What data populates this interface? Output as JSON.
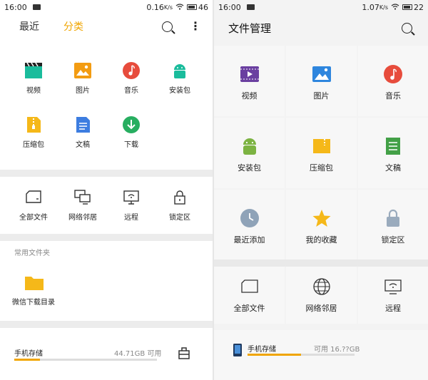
{
  "left": {
    "status": {
      "time": "16:00",
      "net": "0.16",
      "battery": "46"
    },
    "tabs": [
      "最近",
      "分类"
    ],
    "categories": [
      "视频",
      "图片",
      "音乐",
      "安装包",
      "压缩包",
      "文稿",
      "下载"
    ],
    "tools": [
      "全部文件",
      "网络邻居",
      "远程",
      "锁定区"
    ],
    "favorites_title": "常用文件夹",
    "favorite_folder": "微信下载目录",
    "storage": {
      "name": "手机存储",
      "free": "44.71GB 可用",
      "used_fraction": 0.18
    }
  },
  "right": {
    "status": {
      "time": "16:00",
      "net": "1.07",
      "battery": "22"
    },
    "title": "文件管理",
    "grid": [
      "视频",
      "图片",
      "音乐",
      "安装包",
      "压缩包",
      "文稿",
      "最近添加",
      "我的收藏",
      "锁定区"
    ],
    "tools": [
      "全部文件",
      "网络邻居",
      "远程"
    ],
    "storage": {
      "name": "手机存储",
      "free": "可用 16.??GB",
      "used_fraction": 0.5
    }
  },
  "colors": {
    "accent": "#f0a500"
  }
}
